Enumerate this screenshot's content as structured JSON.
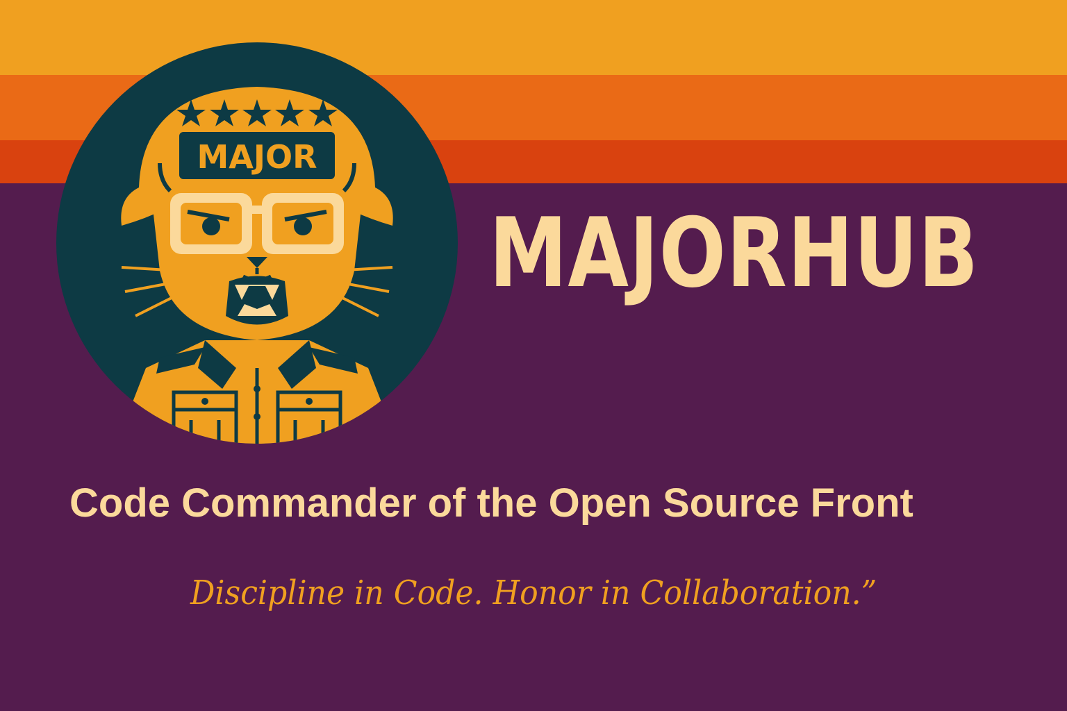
{
  "logo": {
    "helmet_text": "MAJOR",
    "star_count": 5
  },
  "brand": {
    "name": "MAJORHUB"
  },
  "headline": {
    "text": "Code Commander of the Open Source Front"
  },
  "motto": {
    "text": "Discipline in Code. Honor in Collaboration.”"
  },
  "colors": {
    "background": "#541c4e",
    "stripe_top": "#f0a020",
    "stripe_middle": "#ea6a16",
    "stripe_bottom": "#d9420f",
    "badge_circle": "#0d3a44",
    "mascot": "#f0a020",
    "cream": "#fbd99b"
  }
}
